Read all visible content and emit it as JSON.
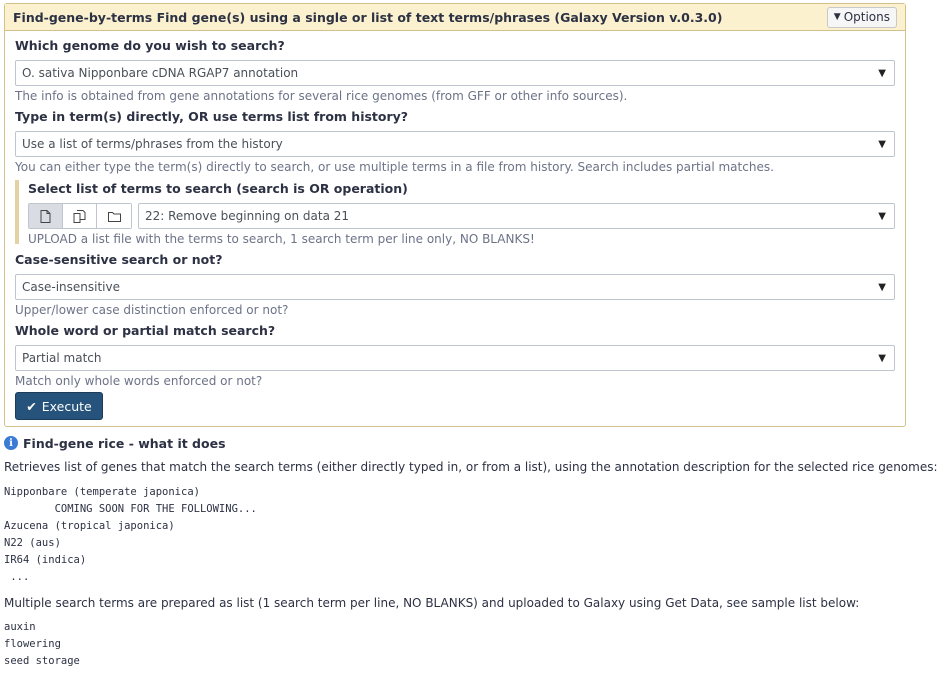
{
  "tool": {
    "title": "Find-gene-by-terms Find gene(s) using a single or list of text terms/phrases (Galaxy Version v.0.3.0)",
    "options_label": "Options"
  },
  "form": {
    "genome": {
      "label": "Which genome do you wish to search?",
      "value": "O. sativa Nipponbare cDNA RGAP7 annotation",
      "help": "The info is obtained from gene annotations for several rice genomes (from GFF or other info sources)."
    },
    "input_mode": {
      "label": "Type in term(s) directly, OR use terms list from history?",
      "value": "Use a list of terms/phrases from the history",
      "help": "You can either type the term(s) directly to search, or use multiple terms in a file from history. Search includes partial matches."
    },
    "terms_list": {
      "label": "Select list of terms to search (search is OR operation)",
      "value": "22: Remove beginning on data 21",
      "help": "UPLOAD a list file with the terms to search, 1 search term per line only, NO BLANKS!"
    },
    "case": {
      "label": "Case-sensitive search or not?",
      "value": "Case-insensitive",
      "help": "Upper/lower case distinction enforced or not?"
    },
    "match": {
      "label": "Whole word or partial match search?",
      "value": "Partial match",
      "help": "Match only whole words enforced or not?"
    },
    "execute_label": "Execute"
  },
  "help": {
    "title": "Find-gene rice - what it does",
    "intro": "Retrieves list of genes that match the search terms (either directly typed in, or from a list), using the annotation description for the selected rice genomes:",
    "genomes_block": "Nipponbare (temperate japonica)\n        COMING SOON FOR THE FOLLOWING...\nAzucena (tropical japonica)\nN22 (aus)\nIR64 (indica)\n ...",
    "multi": "Multiple search terms are prepared as list (1 search term per line, NO BLANKS) and uploaded to Galaxy using Get Data, see sample list below:",
    "sample_block": "auxin\nflowering\nseed storage"
  },
  "colors": {
    "header_bg": "#fbf1cf",
    "panel_border": "#d3c08a",
    "execute_bg": "#25537b",
    "info_icon": "#3a7bd5"
  }
}
